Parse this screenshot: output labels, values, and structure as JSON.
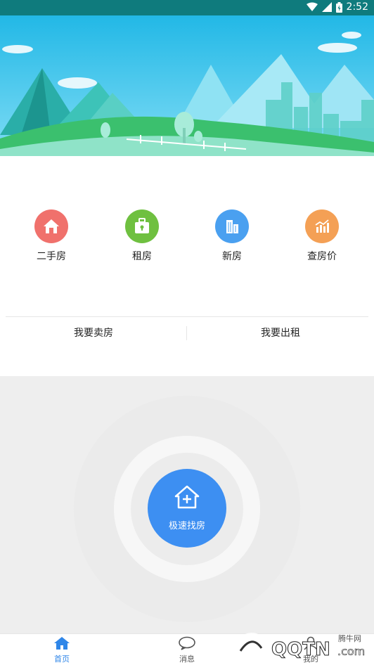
{
  "status_bar": {
    "time": "2:52"
  },
  "categories": [
    {
      "label": "二手房",
      "icon": "house-icon",
      "color": "#f0716c"
    },
    {
      "label": "租房",
      "icon": "suitcase-icon",
      "color": "#6fc040"
    },
    {
      "label": "新房",
      "icon": "building-icon",
      "color": "#4aa0f0"
    },
    {
      "label": "查房价",
      "icon": "price-chart-icon",
      "color": "#f4a055"
    }
  ],
  "actions": {
    "sell": "我要卖房",
    "rent_out": "我要出租"
  },
  "fab": {
    "label": "极速找房",
    "icon": "house-plus-icon"
  },
  "tabs": [
    {
      "label": "首页",
      "icon": "home-icon",
      "active": true
    },
    {
      "label": "消息",
      "icon": "chat-bubble-icon",
      "active": false
    },
    {
      "label": "我的",
      "icon": "user-icon",
      "active": false
    }
  ],
  "watermark": {
    "text": "腾牛网"
  },
  "colors": {
    "primary": "#3d8ff2",
    "status_bar": "#0f7b7d"
  }
}
